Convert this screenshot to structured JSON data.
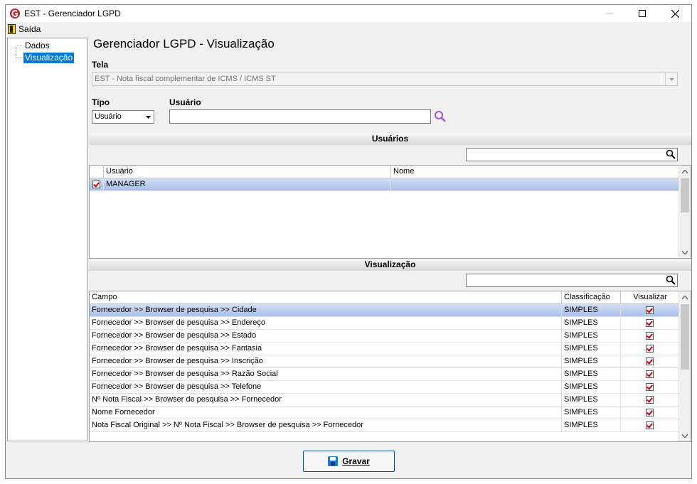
{
  "window": {
    "title": "EST - Gerenciador LGPD"
  },
  "menu": {
    "exit_label": "Saída"
  },
  "tree": {
    "items": [
      "Dados",
      "Visualização"
    ],
    "selected": "Visualização"
  },
  "page_title": "Gerenciador LGPD - Visualização",
  "tela": {
    "label": "Tela",
    "value": "EST - Nota fiscal complementar de ICMS / ICMS ST"
  },
  "tipo": {
    "label": "Tipo",
    "value": "Usuário"
  },
  "usuario": {
    "label": "Usuário",
    "value": ""
  },
  "users_section": {
    "title": "Usuários",
    "columns": [
      "Usuário",
      "Nome"
    ],
    "rows": [
      {
        "usuario": "MANAGER",
        "nome": "",
        "checked": true
      }
    ]
  },
  "view_section": {
    "title": "Visualização",
    "columns": [
      "Campo",
      "Classificação",
      "Visualizar"
    ],
    "rows": [
      {
        "campo": "Fornecedor >> Browser de pesquisa >> Cidade",
        "classificacao": "SIMPLES",
        "visualizar": true
      },
      {
        "campo": "Fornecedor >> Browser de pesquisa >> Endereço",
        "classificacao": "SIMPLES",
        "visualizar": true
      },
      {
        "campo": "Fornecedor >> Browser de pesquisa >> Estado",
        "classificacao": "SIMPLES",
        "visualizar": true
      },
      {
        "campo": "Fornecedor >> Browser de pesquisa >> Fantasia",
        "classificacao": "SIMPLES",
        "visualizar": true
      },
      {
        "campo": "Fornecedor >> Browser de pesquisa >> Inscrição",
        "classificacao": "SIMPLES",
        "visualizar": true
      },
      {
        "campo": "Fornecedor >> Browser de pesquisa >> Razão Social",
        "classificacao": "SIMPLES",
        "visualizar": true
      },
      {
        "campo": "Fornecedor >> Browser de pesquisa >> Telefone",
        "classificacao": "SIMPLES",
        "visualizar": true
      },
      {
        "campo": "Nº Nota Fiscal >> Browser de pesquisa >> Fornecedor",
        "classificacao": "SIMPLES",
        "visualizar": true
      },
      {
        "campo": "Nome Fornecedor",
        "classificacao": "SIMPLES",
        "visualizar": true
      },
      {
        "campo": "Nota Fiscal Original >> Nº Nota Fiscal >> Browser de pesquisa >> Fornecedor",
        "classificacao": "SIMPLES",
        "visualizar": true
      }
    ]
  },
  "save_button": {
    "label": "Gravar"
  },
  "colors": {
    "selection": "#a9bfe9",
    "check": "#d00000",
    "save_icon": "#1e78d8",
    "lookup_icon": "#9b59d0"
  }
}
